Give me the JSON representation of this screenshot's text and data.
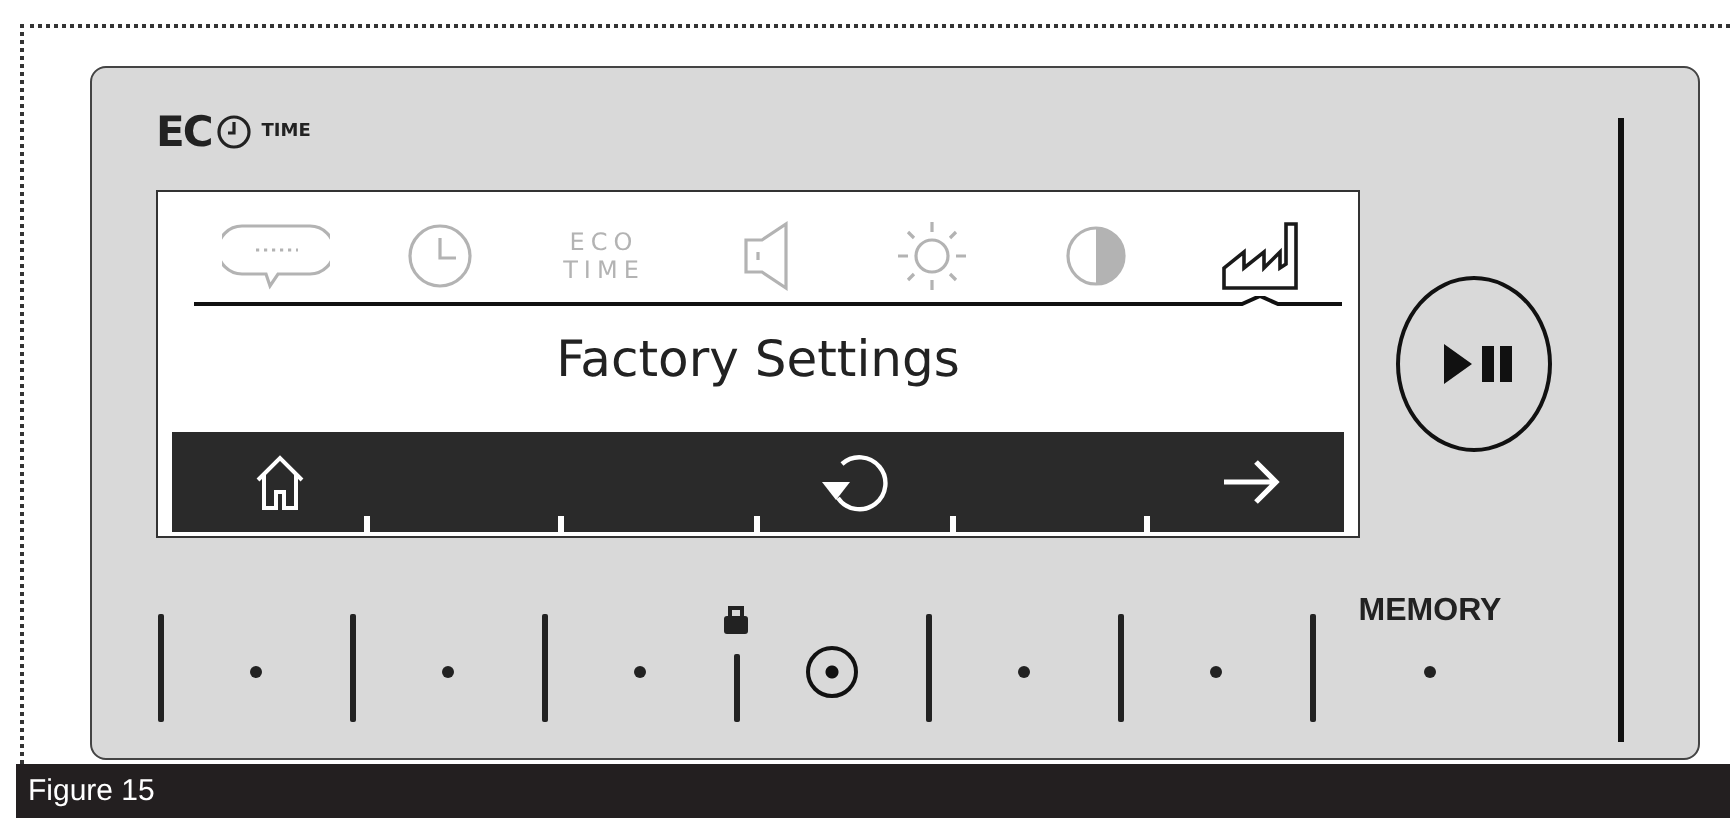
{
  "logo": {
    "brand": "EC",
    "suffix": "TIME"
  },
  "screen": {
    "menu": [
      {
        "kind": "chat",
        "selected": false
      },
      {
        "kind": "clock",
        "selected": false
      },
      {
        "kind": "eco_time",
        "label": "ECO TIME",
        "selected": false
      },
      {
        "kind": "speaker",
        "selected": false
      },
      {
        "kind": "brightness",
        "selected": false
      },
      {
        "kind": "contrast",
        "selected": false
      },
      {
        "kind": "factory",
        "selected": true
      }
    ],
    "title": "Factory Settings",
    "soft_keys": [
      {
        "kind": "home"
      },
      {
        "kind": "blank"
      },
      {
        "kind": "blank"
      },
      {
        "kind": "reset"
      },
      {
        "kind": "blank"
      },
      {
        "kind": "next"
      }
    ]
  },
  "keys": [
    {
      "kind": "divider"
    },
    {
      "kind": "dot"
    },
    {
      "kind": "divider"
    },
    {
      "kind": "dot"
    },
    {
      "kind": "divider"
    },
    {
      "kind": "dot"
    },
    {
      "kind": "lock"
    },
    {
      "kind": "target"
    },
    {
      "kind": "divider"
    },
    {
      "kind": "dot"
    },
    {
      "kind": "divider"
    },
    {
      "kind": "dot"
    },
    {
      "kind": "divider"
    },
    {
      "kind": "memory",
      "label": "MEMORY"
    }
  ],
  "caption": "Figure 15"
}
